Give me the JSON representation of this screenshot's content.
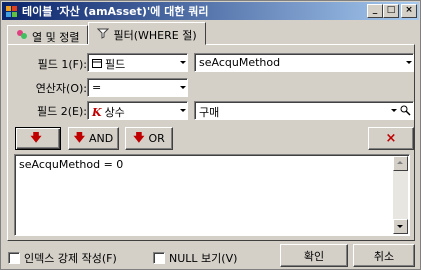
{
  "window": {
    "title": "테이블 '자산 (amAsset)'에 대한 쿼리",
    "buttons": {
      "minimize": "_",
      "maximize": "□",
      "close": "×"
    }
  },
  "tabs": [
    {
      "label": "열 및 정렬",
      "icon": "column-sort-icon"
    },
    {
      "label": "필터(WHERE 절)",
      "icon": "filter-icon"
    }
  ],
  "form": {
    "field1_label": "필드 1(F):",
    "field1_type": "필드",
    "field1_value": "seAcquMethod",
    "operator_label": "연산자(O):",
    "operator_value": "=",
    "field2_label": "필드 2(E):",
    "field2_type": "상수",
    "field2_value": "구매"
  },
  "actions": {
    "insert_label": "",
    "and_label": "AND",
    "or_label": "OR",
    "delete_label": "×"
  },
  "query_text": "seAcquMethod = 0",
  "footer": {
    "index_label": "인덱스 강제 작성(F)",
    "null_label": "NULL 보기(V)",
    "ok_label": "확인",
    "cancel_label": "취소"
  },
  "colors": {
    "accent_red": "#c00000",
    "title_start": "#0a246a",
    "title_end": "#a6caf0"
  }
}
